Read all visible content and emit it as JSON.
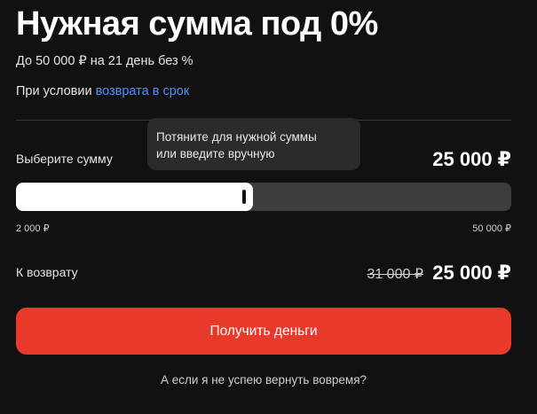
{
  "header": {
    "title": "Нужная сумма под 0%",
    "subtitle": "До 50 000 ₽ на 21 день без %",
    "condition_prefix": "При условии ",
    "condition_link": "возврата в срок"
  },
  "selector": {
    "label": "Выберите сумму",
    "tooltip_line1": "Потяните для нужной суммы",
    "tooltip_line2": "или введите вручную",
    "amount": "25 000 ₽",
    "min_label": "2 000 ₽",
    "max_label": "50 000 ₽",
    "min_value": 2000,
    "max_value": 50000,
    "value": 25000
  },
  "repayment": {
    "label": "К возврату",
    "old_amount": "31 000 ₽",
    "amount": "25 000 ₽"
  },
  "actions": {
    "get_money_label": "Получить деньги",
    "late_link": "А если я не успею вернуть вовремя?"
  },
  "colors": {
    "background": "#111111",
    "accent": "#e8392b",
    "link": "#4d8dff",
    "slider_track": "#3d3d3d",
    "slider_fill": "#ffffff"
  }
}
